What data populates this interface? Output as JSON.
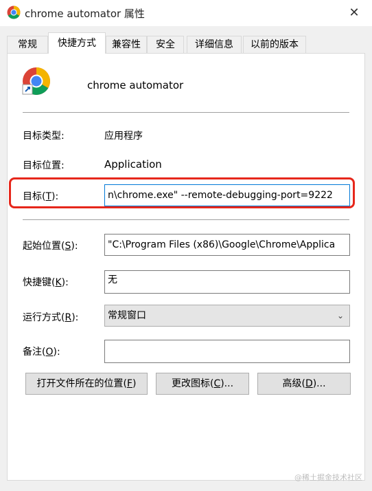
{
  "window": {
    "title": "chrome automator 属性",
    "close_glyph": "✕"
  },
  "tabs": [
    {
      "label": "常规",
      "active": false
    },
    {
      "label": "快捷方式",
      "active": true
    },
    {
      "label": "兼容性",
      "active": false
    },
    {
      "label": "安全",
      "active": false
    },
    {
      "label": "详细信息",
      "active": false
    },
    {
      "label": "以前的版本",
      "active": false
    }
  ],
  "shortcut": {
    "name": "chrome automator"
  },
  "info": {
    "target_type_label": "目标类型:",
    "target_type_value": "应用程序",
    "target_location_label": "目标位置:",
    "target_location_value": "Application"
  },
  "target": {
    "label_pre": "目标(",
    "label_key": "T",
    "label_post": "):",
    "value": "n\\chrome.exe\" --remote-debugging-port=9222"
  },
  "start_in": {
    "label_pre": "起始位置(",
    "label_key": "S",
    "label_post": "):",
    "value": "\"C:\\Program Files (x86)\\Google\\Chrome\\Applica"
  },
  "hotkey": {
    "label_pre": "快捷键(",
    "label_key": "K",
    "label_post": "):",
    "value": "无"
  },
  "run": {
    "label_pre": "运行方式(",
    "label_key": "R",
    "label_post": "):",
    "value": "常规窗口"
  },
  "comment": {
    "label_pre": "备注(",
    "label_key": "O",
    "label_post": "):",
    "value": ""
  },
  "buttons": {
    "open_location_pre": "打开文件所在的位置(",
    "open_location_key": "F",
    "open_location_post": ")",
    "change_icon_pre": "更改图标(",
    "change_icon_key": "C",
    "change_icon_post": ")...",
    "advanced_pre": "高级(",
    "advanced_key": "D",
    "advanced_post": ")..."
  },
  "watermark": "@稀土掘金技术社区",
  "colors": {
    "highlight": "#e6271b",
    "focus_border": "#0078d7"
  }
}
